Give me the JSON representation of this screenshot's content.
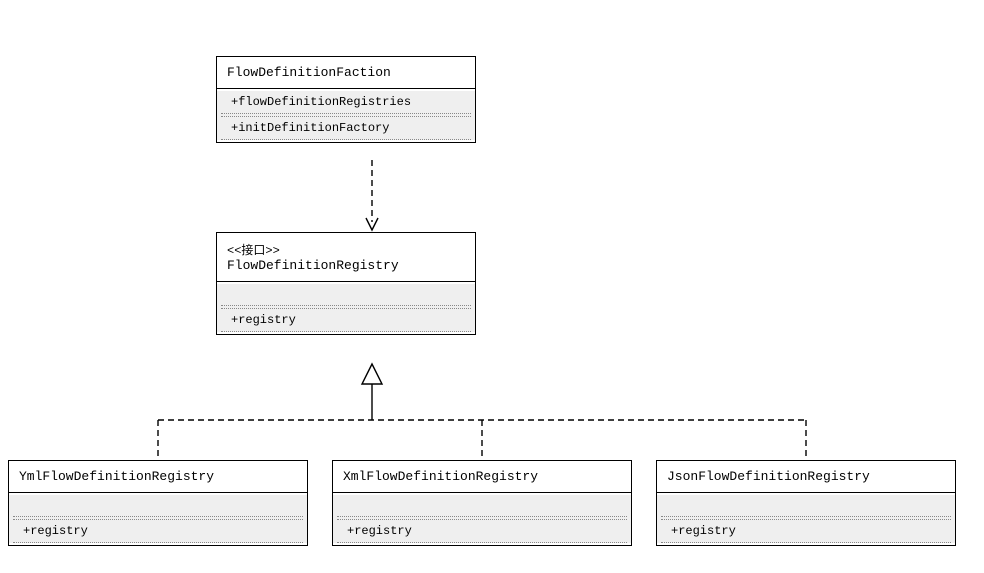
{
  "diagram": {
    "type": "uml_class_diagram",
    "classes": {
      "faction": {
        "name": "FlowDefinitionFaction",
        "attributes": [
          "+flowDefinitionRegistries"
        ],
        "operations": [
          "+initDefinitionFactory"
        ]
      },
      "registry_interface": {
        "stereotype": "<<接口>>",
        "name": "FlowDefinitionRegistry",
        "attributes": [],
        "operations": [
          "+registry"
        ]
      },
      "yml": {
        "name": "YmlFlowDefinitionRegistry",
        "attributes": [],
        "operations": [
          "+registry"
        ]
      },
      "xml": {
        "name": "XmlFlowDefinitionRegistry",
        "attributes": [],
        "operations": [
          "+registry"
        ]
      },
      "json": {
        "name": "JsonFlowDefinitionRegistry",
        "attributes": [],
        "operations": [
          "+registry"
        ]
      }
    },
    "relationships": [
      {
        "from": "faction",
        "to": "registry_interface",
        "type": "dependency"
      },
      {
        "from": "yml",
        "to": "registry_interface",
        "type": "realization"
      },
      {
        "from": "xml",
        "to": "registry_interface",
        "type": "realization"
      },
      {
        "from": "json",
        "to": "registry_interface",
        "type": "realization"
      }
    ]
  }
}
